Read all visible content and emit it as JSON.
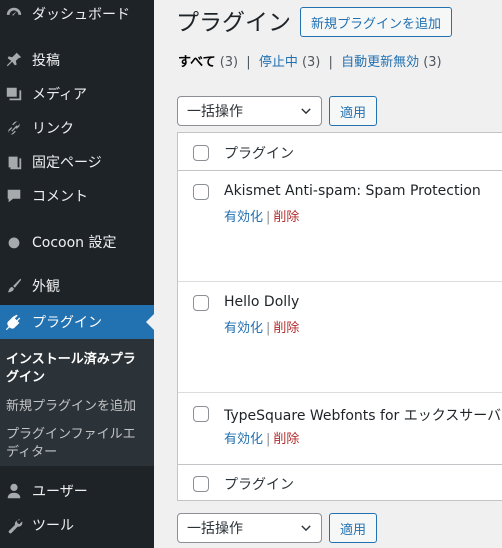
{
  "sidebar": {
    "items": [
      {
        "label": "ダッシュボード",
        "icon": "dashboard-icon"
      },
      {
        "label": "投稿",
        "icon": "pin-icon"
      },
      {
        "label": "メディア",
        "icon": "media-icon"
      },
      {
        "label": "リンク",
        "icon": "link-icon"
      },
      {
        "label": "固定ページ",
        "icon": "pages-icon"
      },
      {
        "label": "コメント",
        "icon": "comment-icon"
      },
      {
        "label": "Cocoon 設定",
        "icon": "circle-icon"
      },
      {
        "label": "外観",
        "icon": "brush-icon"
      },
      {
        "label": "プラグイン",
        "icon": "plugin-icon",
        "active": true
      },
      {
        "label": "ユーザー",
        "icon": "user-icon"
      },
      {
        "label": "ツール",
        "icon": "wrench-icon"
      }
    ],
    "submenu": [
      {
        "label": "インストール済みプラグイン",
        "current": true
      },
      {
        "label": "新規プラグインを追加"
      },
      {
        "label": "プラグインファイルエディター"
      }
    ]
  },
  "header": {
    "title": "プラグイン",
    "add_new": "新規プラグインを追加"
  },
  "filters": [
    {
      "label": "すべて",
      "count": "(3)",
      "current": true
    },
    {
      "label": "停止中",
      "count": "(3)"
    },
    {
      "label": "自動更新無効",
      "count": "(3)"
    }
  ],
  "bulk": {
    "select": "一括操作",
    "apply": "適用"
  },
  "table": {
    "column": "プラグイン",
    "plugins": [
      {
        "name": "Akismet Anti-spam: Spam Protection",
        "activate": "有効化",
        "delete": "削除"
      },
      {
        "name": "Hello Dolly",
        "activate": "有効化",
        "delete": "削除"
      },
      {
        "name": "TypeSquare Webfonts for エックスサーバー",
        "activate": "有効化",
        "delete": "削除"
      }
    ]
  },
  "colors": {
    "sidebar_bg": "#1d2327",
    "accent": "#2271b1",
    "delete": "#b32d2e"
  }
}
